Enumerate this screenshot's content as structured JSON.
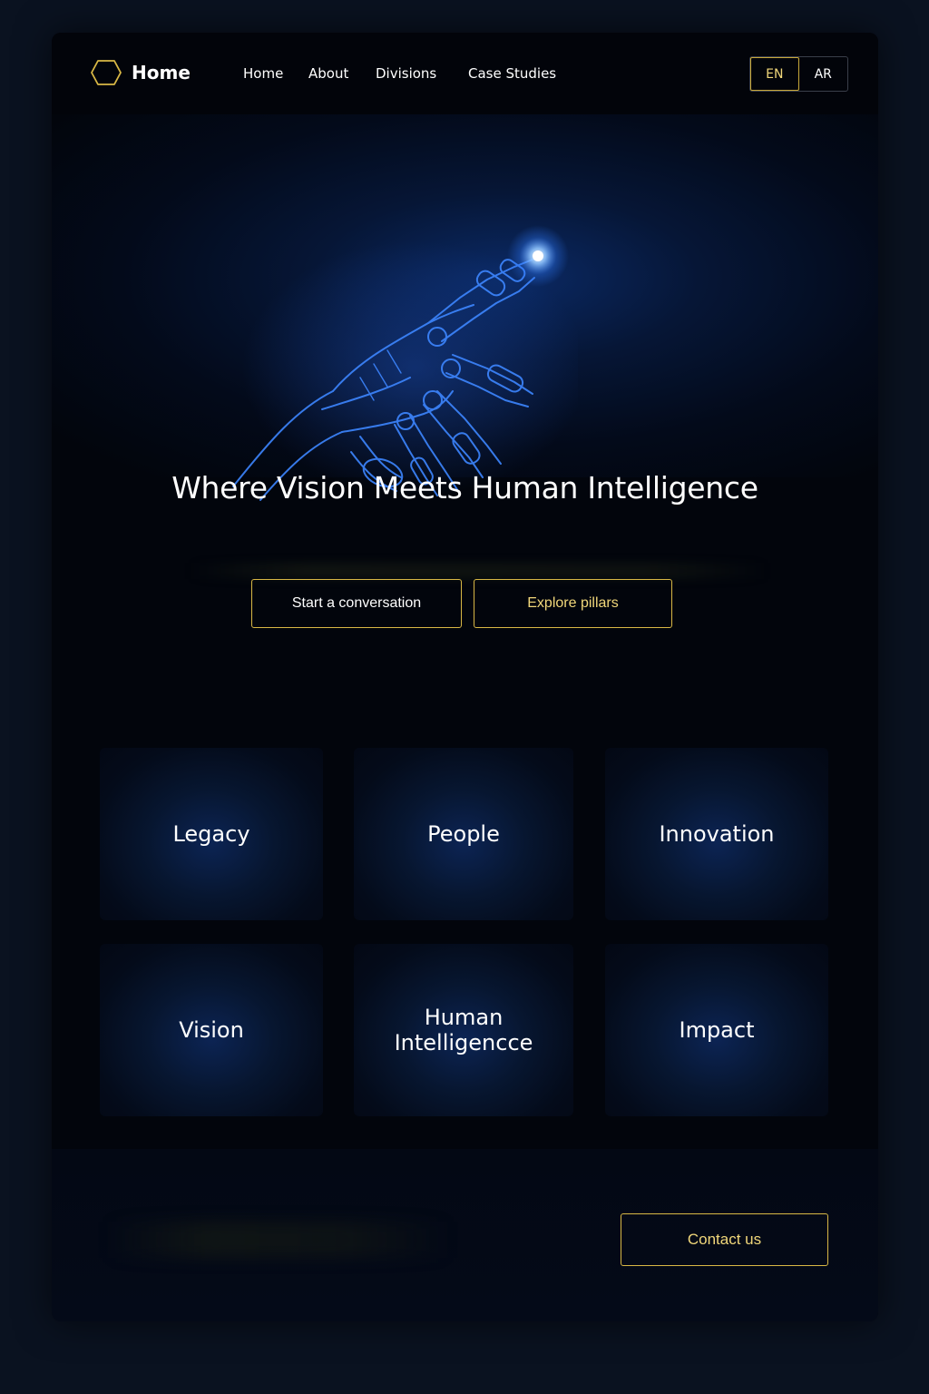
{
  "header": {
    "brand": "Home",
    "nav": [
      "Home",
      "About",
      "Divisions",
      "Case Studies"
    ],
    "languages": [
      "EN",
      "AR"
    ],
    "active_language": "EN"
  },
  "hero": {
    "headline": "Where Vision Meets Human Intelligence",
    "primary_cta": "Start a conversation",
    "secondary_cta": "Explore pillars"
  },
  "pillars": [
    "Legacy",
    "People",
    "Innovation",
    "Vision",
    "Human Intelligencce",
    "Impact"
  ],
  "footer": {
    "contact_cta": "Contact us"
  },
  "colors": {
    "accent_gold": "#d9b845",
    "background": "#02050c",
    "glow_blue": "#2f7bff"
  }
}
